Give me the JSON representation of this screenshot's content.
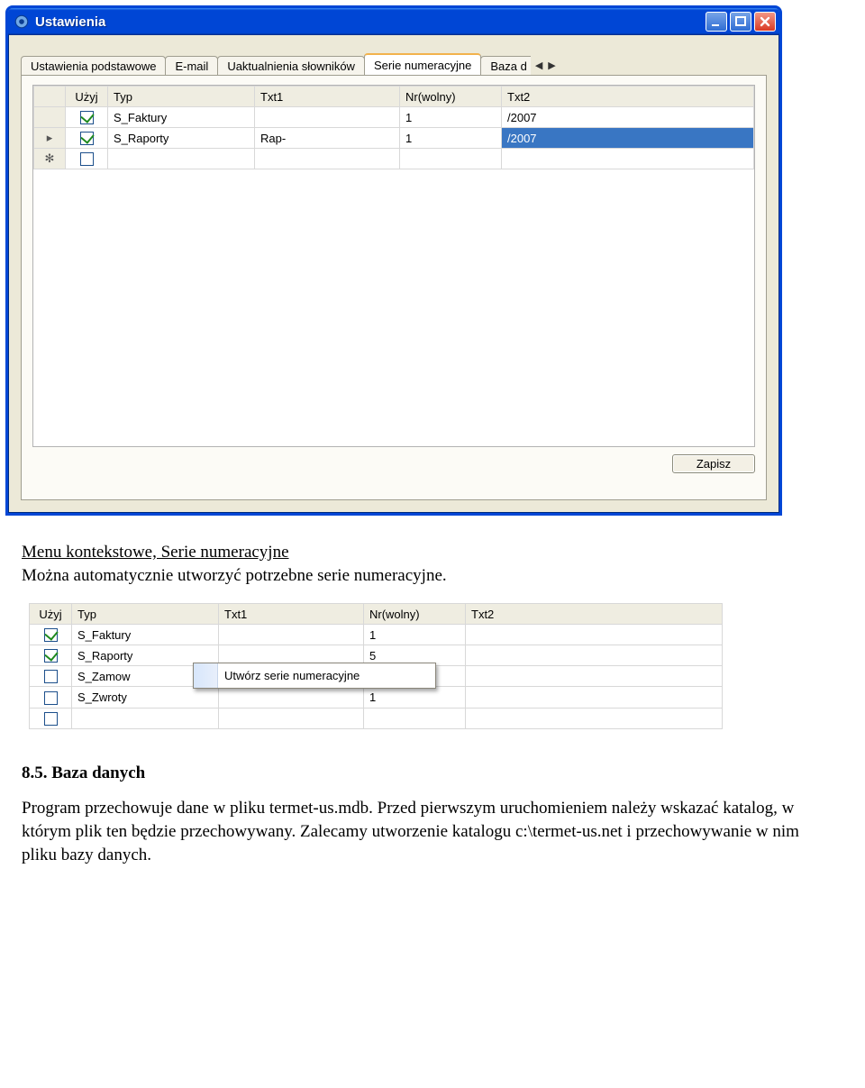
{
  "window": {
    "title": "Ustawienia"
  },
  "tabs": {
    "t1": "Ustawienia podstawowe",
    "t2": "E-mail",
    "t3": "Uaktualnienia słowników",
    "t4": "Serie numeracyjne",
    "t5": "Baza d"
  },
  "grid1": {
    "col_use": "Użyj",
    "col_typ": "Typ",
    "col_t1": "Txt1",
    "col_nr": "Nr(wolny)",
    "col_t2": "Txt2",
    "rows": [
      {
        "use": true,
        "typ": "S_Faktury",
        "t1": "",
        "nr": "1",
        "t2": "/2007"
      },
      {
        "use": true,
        "typ": "S_Raporty",
        "t1": "Rap-",
        "nr": "1",
        "t2": "/2007"
      }
    ]
  },
  "buttons": {
    "zapisz": "Zapisz"
  },
  "doc": {
    "p1_u": "Menu kontekstowe, Serie numeracyjne",
    "p1_rest": "Można automatycznie utworzyć potrzebne serie numeracyjne.",
    "h2": "8.5. Baza danych",
    "p2": "Program przechowuje dane w pliku termet-us.mdb. Przed pierwszym uruchomieniem należy wskazać katalog, w którym plik ten będzie przechowywany. Zalecamy utworzenie katalogu c:\\termet-us.net i przechowywanie w nim pliku bazy danych."
  },
  "grid2": {
    "col_use": "Użyj",
    "col_typ": "Typ",
    "col_t1": "Txt1",
    "col_nr": "Nr(wolny)",
    "col_t2": "Txt2",
    "rows": [
      {
        "use": true,
        "typ": "S_Faktury",
        "t1": "",
        "nr": "1",
        "t2": ""
      },
      {
        "use": true,
        "typ": "S_Raporty",
        "t1": "",
        "nr": "5",
        "t2": ""
      },
      {
        "use": false,
        "typ": "S_Zamow",
        "t1": "",
        "nr": "",
        "t2": ""
      },
      {
        "use": false,
        "typ": "S_Zwroty",
        "t1": "",
        "nr": "1",
        "t2": ""
      }
    ]
  },
  "contextmenu": {
    "item1": "Utwórz serie numeracyjne"
  }
}
